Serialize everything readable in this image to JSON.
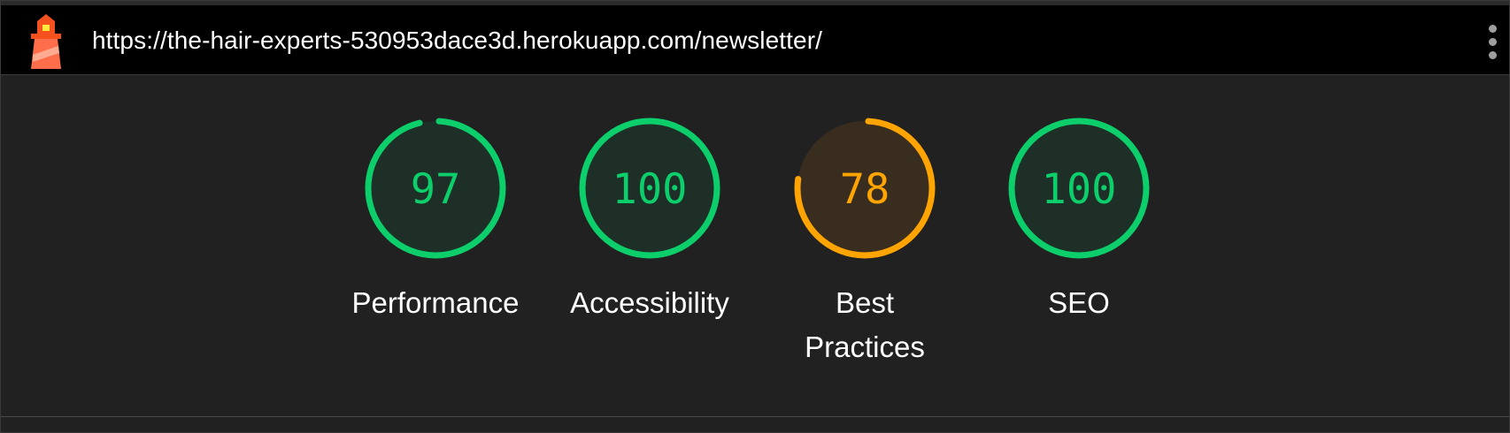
{
  "header": {
    "url": "https://the-hair-experts-530953dace3d.herokuapp.com/newsletter/",
    "logo_icon": "lighthouse-icon",
    "menu_icon": "kebab-menu-icon"
  },
  "colors": {
    "pass": "#0cce6b",
    "average": "#ffa400",
    "pass_fill": "#1e2f27",
    "average_fill": "#392d1f"
  },
  "gauges": [
    {
      "label": "Performance",
      "value": "97",
      "score": 0.97,
      "status": "pass"
    },
    {
      "label": "Accessibility",
      "value": "100",
      "score": 1.0,
      "status": "pass"
    },
    {
      "label": "Best Practices",
      "value": "78",
      "score": 0.78,
      "status": "average"
    },
    {
      "label": "SEO",
      "value": "100",
      "score": 1.0,
      "status": "pass"
    }
  ]
}
